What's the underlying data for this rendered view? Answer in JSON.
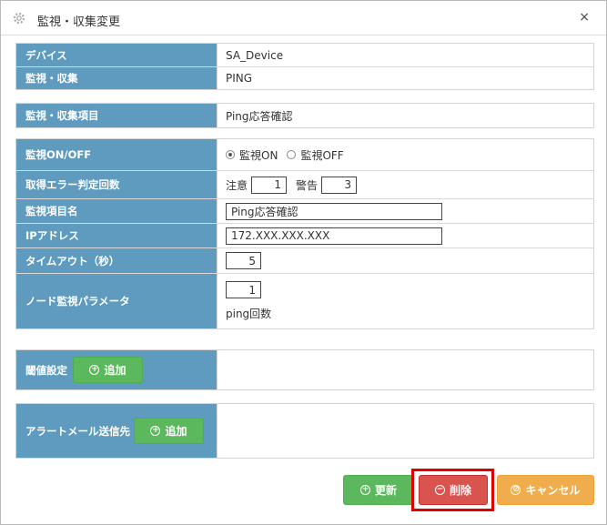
{
  "dialog": {
    "title": "監視・収集変更",
    "close_glyph": "×",
    "gear_icon": "gear-icon"
  },
  "info": {
    "device_label": "デバイス",
    "device_value": "SA_Device",
    "collect_label": "監視・収集",
    "collect_value": "PING",
    "item_label": "監視・収集項目",
    "item_value": "Ping応答確認"
  },
  "settings": {
    "onoff_label": "監視ON/OFF",
    "on_label": "監視ON",
    "off_label": "監視OFF",
    "selected": "on",
    "error_label": "取得エラー判定回数",
    "caution_label": "注意",
    "caution_value": "1",
    "warning_label": "警告",
    "warning_value": "3",
    "name_label": "監視項目名",
    "name_value": "Ping応答確認",
    "ip_label": "IPアドレス",
    "ip_value": "172.XXX.XXX.XXX",
    "timeout_label": "タイムアウト（秒）",
    "timeout_value": "5",
    "param_label": "ノード監視パラメータ",
    "param_value": "1",
    "param_caption": "ping回数"
  },
  "threshold": {
    "label": "閾値設定",
    "add_label": "追加"
  },
  "alert": {
    "label": "アラートメール送信先",
    "add_label": "追加"
  },
  "footer": {
    "update_label": "更新",
    "delete_label": "削除",
    "cancel_label": "キャンセル"
  },
  "colors": {
    "label_bg": "#5e9bbe",
    "green": "#5cb85c",
    "red": "#d9534f",
    "orange": "#f0ad4e",
    "highlight": "#e00000"
  }
}
